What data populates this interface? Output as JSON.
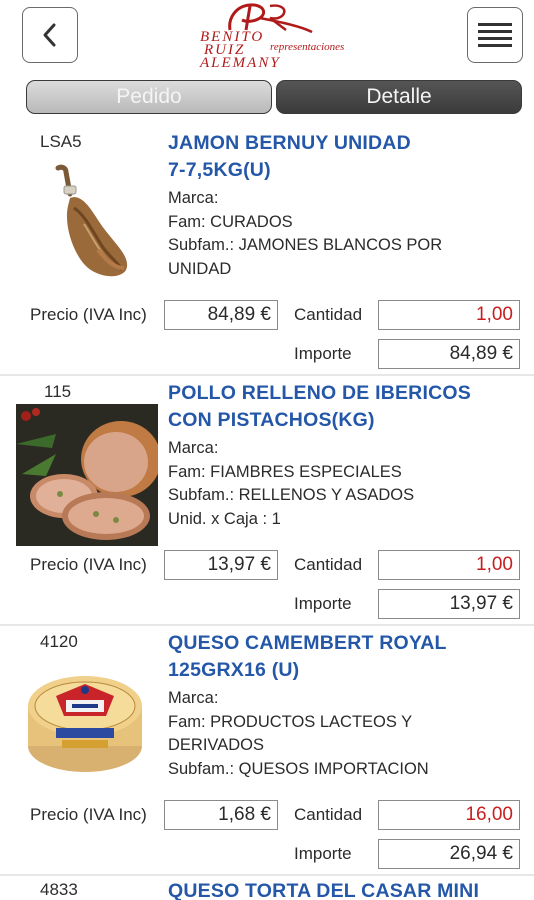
{
  "header": {
    "logo": {
      "line1": "BENITO",
      "line2": "RUIZ",
      "line3": "ALEMANY",
      "tagline": "representaciones"
    }
  },
  "tabs": [
    {
      "label": "Pedido",
      "active": false
    },
    {
      "label": "Detalle",
      "active": true
    }
  ],
  "labels": {
    "precio": "Precio (IVA Inc)",
    "cantidad": "Cantidad",
    "importe": "Importe"
  },
  "items": [
    {
      "code": "LSA5",
      "title_line1": "JAMON BERNUY UNIDAD",
      "title_line2": "7-7,5KG(U)",
      "marca": "Marca:",
      "fam": "Fam:  CURADOS",
      "subfam_line1": "Subfam.: JAMONES BLANCOS POR",
      "subfam_line2": "UNIDAD",
      "precio": "84,89 €",
      "cantidad": "1,00",
      "importe": "84,89 €",
      "image": "jamon-image"
    },
    {
      "code": "115",
      "title_line1": "POLLO RELLENO DE IBERICOS",
      "title_line2": "CON PISTACHOS(KG)",
      "marca": "Marca:",
      "fam": "Fam:  FIAMBRES ESPECIALES",
      "subfam_line1": "Subfam.: RELLENOS Y ASADOS",
      "unid": "Unid. x Caja :  1",
      "precio": "13,97 €",
      "cantidad": "1,00",
      "importe": "13,97 €",
      "image": "pollo-relleno-image"
    },
    {
      "code": "4120",
      "title_line1": "QUESO CAMEMBERT ROYAL",
      "title_line2": "125GRX16 (U)",
      "marca": "Marca:",
      "fam_line1": "Fam:  PRODUCTOS LACTEOS Y",
      "fam_line2": "DERIVADOS",
      "subfam_line1": "Subfam.: QUESOS IMPORTACION",
      "precio": "1,68 €",
      "cantidad": "16,00",
      "importe": "26,94 €",
      "image": "camembert-image"
    },
    {
      "code": "4833",
      "title_line1": "QUESO TORTA DEL CASAR MINI"
    }
  ],
  "colors": {
    "title_blue": "#2457a8",
    "quantity_red": "#c81e1e",
    "brand_red": "#b11a1a"
  }
}
